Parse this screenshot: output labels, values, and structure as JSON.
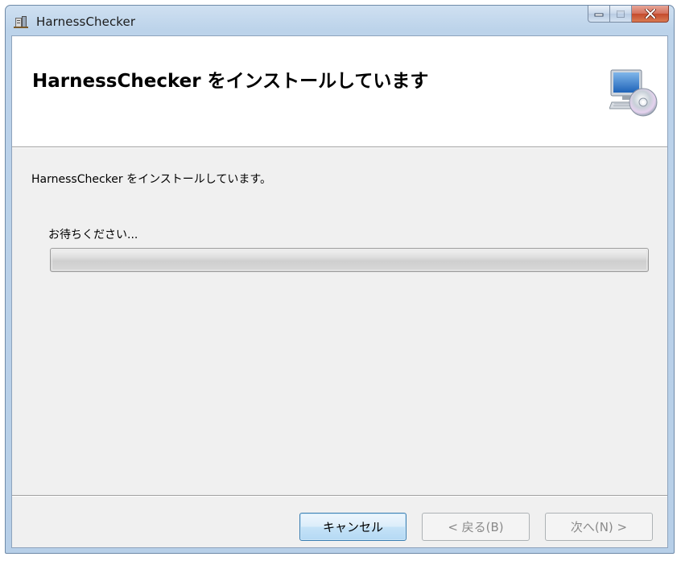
{
  "window": {
    "title": "HarnessChecker",
    "app_icon": "installer-app-icon",
    "caption_buttons": {
      "minimize_icon": "minimize-icon",
      "maximize_icon": "maximize-icon",
      "close_icon": "close-icon"
    }
  },
  "banner": {
    "title": "HarnessChecker をインストールしています",
    "icon": "computer-disc-icon"
  },
  "main": {
    "status_text": "HarnessChecker をインストールしています。",
    "wait_text": "お待ちください...",
    "progress_fraction": 0.0
  },
  "buttons": {
    "cancel_label": "キャンセル",
    "back_label": "< 戻る(B)",
    "next_label": "次へ(N) >"
  },
  "colors": {
    "titlebar_accent": "#bcd3ea",
    "close_button": "#c44a2c",
    "dialog_background": "#f0f0f0",
    "default_button_border": "#3c7fb1"
  }
}
